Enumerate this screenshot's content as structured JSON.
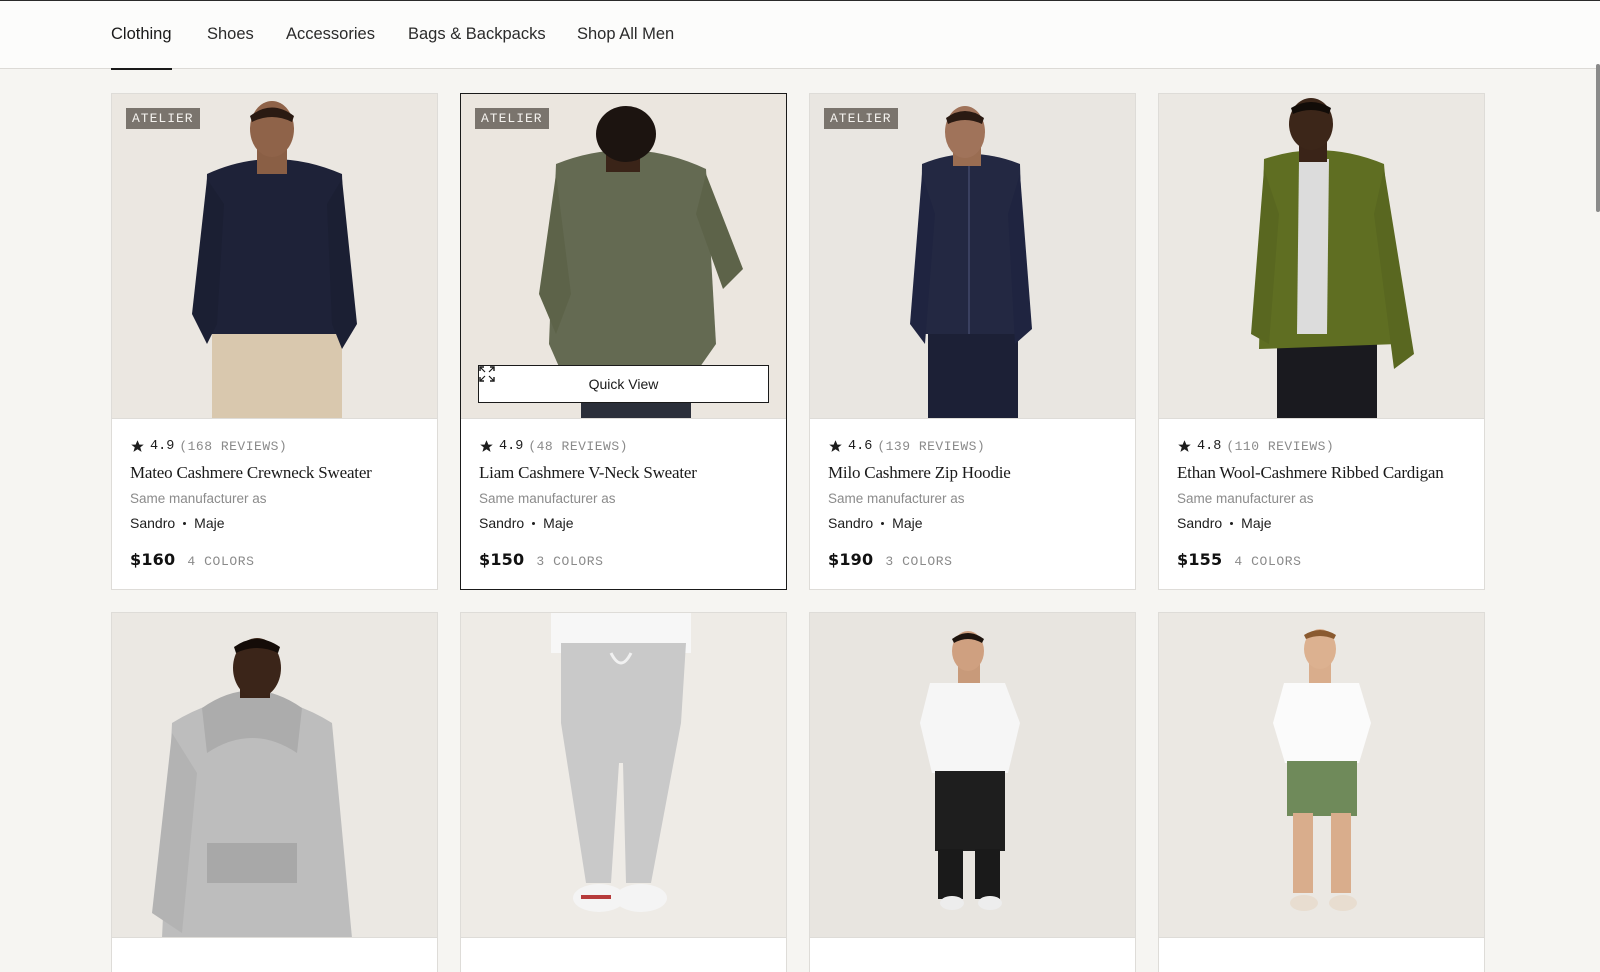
{
  "nav": {
    "tabs": [
      {
        "label": "Clothing",
        "active": true
      },
      {
        "label": "Shoes",
        "active": false
      },
      {
        "label": "Accessories",
        "active": false
      },
      {
        "label": "Bags & Backpacks",
        "active": false
      },
      {
        "label": "Shop All Men",
        "active": false
      }
    ]
  },
  "products": [
    {
      "badge": "ATELIER",
      "rating": "4.9",
      "reviews": "(168 REVIEWS)",
      "name": "Mateo Cashmere Crewneck Sweater",
      "manufacturer_note": "Same manufacturer as",
      "brand_a": "Sandro",
      "brand_b": "Maje",
      "price": "$160",
      "colors": "4 COLORS"
    },
    {
      "badge": "ATELIER",
      "rating": "4.9",
      "reviews": "(48 REVIEWS)",
      "name": "Liam Cashmere V-Neck Sweater",
      "manufacturer_note": "Same manufacturer as",
      "brand_a": "Sandro",
      "brand_b": "Maje",
      "price": "$150",
      "colors": "3 COLORS",
      "quick_view_label": "Quick View"
    },
    {
      "badge": "ATELIER",
      "rating": "4.6",
      "reviews": "(139 REVIEWS)",
      "name": "Milo Cashmere Zip Hoodie",
      "manufacturer_note": "Same manufacturer as",
      "brand_a": "Sandro",
      "brand_b": "Maje",
      "price": "$190",
      "colors": "3 COLORS"
    },
    {
      "rating": "4.8",
      "reviews": "(110 REVIEWS)",
      "name": "Ethan Wool-Cashmere Ribbed Cardigan",
      "manufacturer_note": "Same manufacturer as",
      "brand_a": "Sandro",
      "brand_b": "Maje",
      "price": "$155",
      "colors": "4 COLORS"
    }
  ],
  "colors": {
    "background": "#f6f5f2",
    "card": "#ffffff",
    "badge": "#7a746d",
    "muted_text": "#8a8a8a",
    "accent": "#1a1a1a"
  }
}
